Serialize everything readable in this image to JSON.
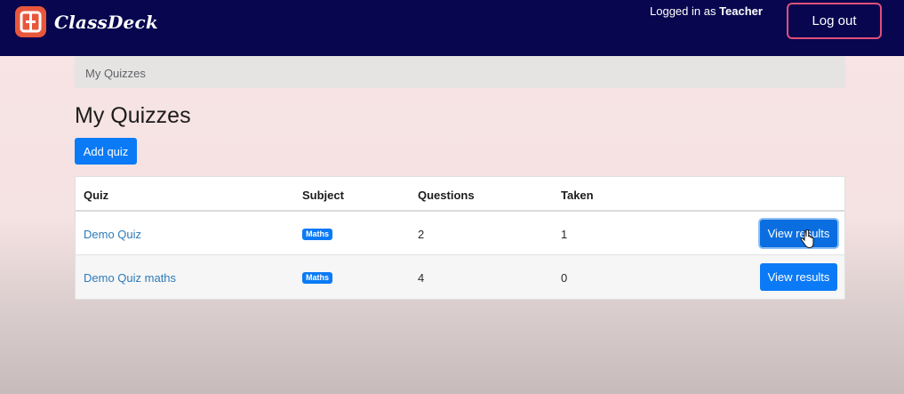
{
  "header": {
    "brand": "ClassDeck",
    "login_prefix": "Logged in as",
    "login_user": "Teacher",
    "logout_label": "Log out",
    "brand_color": "#e8573c",
    "nav_color": "#07064f"
  },
  "breadcrumb": {
    "current": "My Quizzes"
  },
  "page": {
    "title": "My Quizzes",
    "add_label": "Add quiz"
  },
  "table": {
    "columns": [
      "Quiz",
      "Subject",
      "Questions",
      "Taken"
    ],
    "rows": [
      {
        "quiz": "Demo Quiz",
        "subject": "Maths",
        "questions": "2",
        "taken": "1",
        "action": "View results"
      },
      {
        "quiz": "Demo Quiz maths",
        "subject": "Maths",
        "questions": "4",
        "taken": "0",
        "action": "View results"
      }
    ]
  },
  "accent_color": "#0b7af6"
}
